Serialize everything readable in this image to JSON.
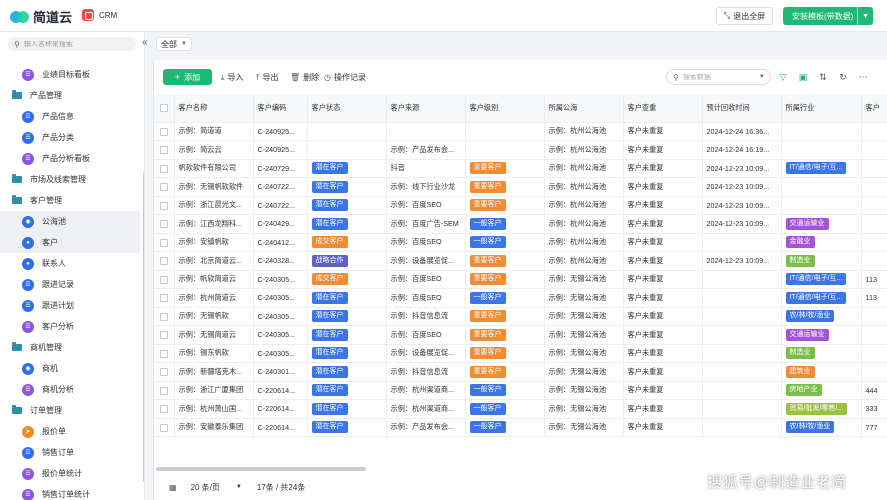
{
  "topbar": {
    "logo_text": "简道云",
    "app_name": "CRM",
    "exit_fullscreen": "退出全屏",
    "install_template": "安装模板(带数据)"
  },
  "sidebar": {
    "search_placeholder": "输入名称来搜索",
    "items": [
      {
        "label": "业绩目标看板",
        "type": "child",
        "icon": "purple",
        "glyph": "☰"
      },
      {
        "label": "产品管理",
        "type": "group"
      },
      {
        "label": "产品信息",
        "type": "child",
        "icon": "blue",
        "glyph": "☰"
      },
      {
        "label": "产品分类",
        "type": "child",
        "icon": "blue",
        "glyph": "☰"
      },
      {
        "label": "产品分析看板",
        "type": "child",
        "icon": "purple",
        "glyph": "☰"
      },
      {
        "label": "市场及线索管理",
        "type": "group"
      },
      {
        "label": "客户管理",
        "type": "group"
      },
      {
        "label": "公海池",
        "type": "child",
        "icon": "blue",
        "glyph": "◉",
        "active": true
      },
      {
        "label": "客户",
        "type": "child",
        "icon": "blue",
        "glyph": "●",
        "active": true
      },
      {
        "label": "联系人",
        "type": "child",
        "icon": "blue",
        "glyph": "●"
      },
      {
        "label": "跟进记录",
        "type": "child",
        "icon": "blue",
        "glyph": "☰"
      },
      {
        "label": "跟进计划",
        "type": "child",
        "icon": "blue",
        "glyph": "☰"
      },
      {
        "label": "客户分析",
        "type": "child",
        "icon": "purple",
        "glyph": "☰"
      },
      {
        "label": "商机管理",
        "type": "group"
      },
      {
        "label": "商机",
        "type": "child",
        "icon": "blue",
        "glyph": "◉"
      },
      {
        "label": "商机分析",
        "type": "child",
        "icon": "purple",
        "glyph": "☰"
      },
      {
        "label": "订单管理",
        "type": "group"
      },
      {
        "label": "报价单",
        "type": "child",
        "icon": "orange",
        "glyph": "➤"
      },
      {
        "label": "销售订单",
        "type": "child",
        "icon": "blue",
        "glyph": "☰"
      },
      {
        "label": "报价单统计",
        "type": "child",
        "icon": "purple",
        "glyph": "☰"
      },
      {
        "label": "销售订单统计",
        "type": "child",
        "icon": "purple",
        "glyph": "☰"
      }
    ]
  },
  "view_selector": "全部",
  "toolbar": {
    "add": "添加",
    "import": "导入",
    "export": "导出",
    "delete": "删除",
    "operation_log": "操作记录",
    "search_placeholder": "搜索数据"
  },
  "table": {
    "columns": [
      "客户名称",
      "客户编码",
      "客户状态",
      "客户来源",
      "客户级别",
      "所属公海",
      "客户查重",
      "预计回收时间",
      "所属行业",
      "客户"
    ],
    "rows": [
      {
        "name": "示例：简道道",
        "code": "C-240925...",
        "status": "",
        "source": "",
        "level": "",
        "sea": "示例：杭州公海池",
        "dup": "客户未重复",
        "time": "2024-12-24 16:36...",
        "industry": "",
        "last": ""
      },
      {
        "name": "示例：简云云",
        "code": "C-240925...",
        "status": "",
        "source": "示例：产品发布会...",
        "level": "",
        "sea": "示例：杭州公海池",
        "dup": "客户未重复",
        "time": "2024-12-24 16:19...",
        "industry": "",
        "last": ""
      },
      {
        "name": "帆软软件有限公司",
        "code": "C-240729...",
        "status": "潜在客户",
        "source": "抖音",
        "level": "重要客户",
        "sea": "示例：杭州公海池",
        "dup": "客户未重复",
        "time": "2024-12-23 10:09...",
        "industry": "IT/通信/电子/互...",
        "last": ""
      },
      {
        "name": "示例：无锡帆软软件",
        "code": "C-240722...",
        "status": "潜在客户",
        "source": "示例：线下行业沙龙",
        "level": "重要客户",
        "sea": "示例：杭州公海池",
        "dup": "客户未重复",
        "time": "2024-12-23 10:09...",
        "industry": "",
        "last": ""
      },
      {
        "name": "示例：浙江晨光文...",
        "code": "C-240722...",
        "status": "潜在客户",
        "source": "示例：百度SEO",
        "level": "重要客户",
        "sea": "示例：杭州公海池",
        "dup": "客户未重复",
        "time": "2024-12-23 10:09...",
        "industry": "",
        "last": ""
      },
      {
        "name": "示例：江西龙翔科...",
        "code": "C-240429...",
        "status": "潜在客户",
        "source": "示例：百度广告-SEM",
        "level": "一般客户",
        "sea": "示例：杭州公海池",
        "dup": "客户未重复",
        "time": "2024-12-23 10:09...",
        "industry": "交通运输业",
        "last": ""
      },
      {
        "name": "示例：安镇帆软",
        "code": "C-240412...",
        "status": "成交客户",
        "source": "示例：百度SEO",
        "level": "一般客户",
        "sea": "示例：杭州公海池",
        "dup": "客户未重复",
        "time": "",
        "industry": "金融业",
        "last": ""
      },
      {
        "name": "示例：北京简道云...",
        "code": "C-240328...",
        "status": "战略合作",
        "source": "示例：设备展览促...",
        "level": "重要客户",
        "sea": "示例：杭州公海池",
        "dup": "客户未重复",
        "time": "2024-12-23 10:09...",
        "industry": "制造业",
        "last": ""
      },
      {
        "name": "示例：帆软简道云",
        "code": "C-240305...",
        "status": "成交客户",
        "source": "示例：百度SEO",
        "level": "重要客户",
        "sea": "示例：无锡公海池",
        "dup": "客户未重复",
        "time": "",
        "industry": "IT/通信/电子/互...",
        "last": "113"
      },
      {
        "name": "示例：杭州简道云",
        "code": "C-240305...",
        "status": "潜在客户",
        "source": "示例：百度SEO",
        "level": "一般客户",
        "sea": "示例：无锡公海池",
        "dup": "客户未重复",
        "time": "",
        "industry": "IT/通信/电子/互...",
        "last": "113"
      },
      {
        "name": "示例：无锡帆软",
        "code": "C-240305...",
        "status": "潜在客户",
        "source": "示例：抖音信息流",
        "level": "重要客户",
        "sea": "示例：无锡公海池",
        "dup": "客户未重复",
        "time": "",
        "industry": "农/林/牧/渔业",
        "last": ""
      },
      {
        "name": "示例：无锡简道云",
        "code": "C-240305...",
        "status": "潜在客户",
        "source": "示例：百度SEO",
        "level": "重要客户",
        "sea": "示例：无锡公海池",
        "dup": "客户未重复",
        "time": "",
        "industry": "交通运输业",
        "last": ""
      },
      {
        "name": "示例：锡东帆软",
        "code": "C-240305...",
        "status": "潜在客户",
        "source": "示例：设备展览促...",
        "level": "重要客户",
        "sea": "示例：无锡公海池",
        "dup": "客户未重复",
        "time": "",
        "industry": "制造业",
        "last": ""
      },
      {
        "name": "示例：新疆塔克木...",
        "code": "C-240301...",
        "status": "潜在客户",
        "source": "示例：抖音信息流",
        "level": "重要客户",
        "sea": "示例：无锡公海池",
        "dup": "客户未重复",
        "time": "",
        "industry": "建筑业",
        "last": ""
      },
      {
        "name": "示例：浙江广厦集团",
        "code": "C-220614...",
        "status": "潜在客户",
        "source": "示例：杭州渠道商...",
        "level": "一般客户",
        "sea": "示例：无锡公海池",
        "dup": "客户未重复",
        "time": "",
        "industry": "房地产业",
        "last": "444"
      },
      {
        "name": "示例：杭州萧山国...",
        "code": "C-220614...",
        "status": "潜在客户",
        "source": "示例：杭州渠道商...",
        "level": "一般客户",
        "sea": "示例：无锡公海池",
        "dup": "客户未重复",
        "time": "",
        "industry": "贸易/批发/零售/...",
        "last": "333"
      },
      {
        "name": "示例：安徽泰乐集团",
        "code": "C-220614...",
        "status": "潜在客户",
        "source": "示例：产品发布会...",
        "level": "一般客户",
        "sea": "示例：无锡公海池",
        "dup": "客户未重复",
        "time": "",
        "industry": "农/林/牧/渔业",
        "last": "777"
      }
    ]
  },
  "tag_colors": {
    "潜在客户": "blue",
    "成交客户": "orange",
    "战略合作": "purple",
    "重要客户": "orange",
    "一般客户": "blue",
    "IT/通信/电子/互...": "blue",
    "交通运输业": "violet",
    "金融业": "violet",
    "制造业": "green",
    "农/林/牧/渔业": "blue",
    "建筑业": "orange",
    "房地产业": "green",
    "贸易/批发/零售/...": "yellow"
  },
  "pager": {
    "page_size": "20 条/页",
    "total": "17条 / 共24条"
  },
  "watermark": "搜狐号@制造业老简"
}
